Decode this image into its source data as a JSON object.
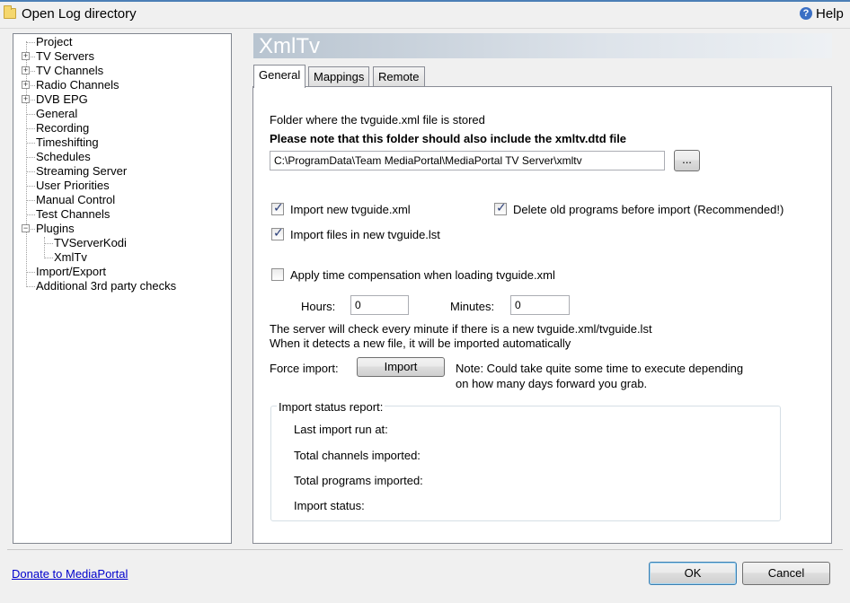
{
  "toolbar": {
    "open_log_label": "Open Log directory",
    "help_label": "Help"
  },
  "tree": {
    "items": [
      {
        "label": "Project"
      },
      {
        "label": "TV Servers"
      },
      {
        "label": "TV Channels"
      },
      {
        "label": "Radio Channels"
      },
      {
        "label": "DVB EPG"
      },
      {
        "label": "General"
      },
      {
        "label": "Recording"
      },
      {
        "label": "Timeshifting"
      },
      {
        "label": "Schedules"
      },
      {
        "label": "Streaming Server"
      },
      {
        "label": "User Priorities"
      },
      {
        "label": "Manual Control"
      },
      {
        "label": "Test Channels"
      },
      {
        "label": "Plugins"
      },
      {
        "label": "TVServerKodi"
      },
      {
        "label": "XmlTv"
      },
      {
        "label": "Import/Export"
      },
      {
        "label": "Additional 3rd party checks"
      }
    ]
  },
  "panel": {
    "title": "XmlTv",
    "tabs": [
      {
        "label": "General"
      },
      {
        "label": "Mappings"
      },
      {
        "label": "Remote"
      }
    ]
  },
  "general": {
    "folder_label": "Folder where the tvguide.xml file is stored",
    "folder_note": "Please note that this folder should also include the xmltv.dtd file",
    "folder_value": "C:\\ProgramData\\Team MediaPortal\\MediaPortal TV Server\\xmltv",
    "browse_label": "...",
    "import_new_label": "Import new tvguide.xml",
    "import_new_checked": true,
    "delete_old_label": "Delete old programs before import (Recommended!)",
    "delete_old_checked": true,
    "import_lst_label": "Import files in new tvguide.lst",
    "import_lst_checked": true,
    "time_comp_label": "Apply time compensation when loading tvguide.xml",
    "time_comp_checked": false,
    "hours_label": "Hours:",
    "hours_value": "0",
    "minutes_label": "Minutes:",
    "minutes_value": "0",
    "info_line1": "The server will check every minute if there is a new tvguide.xml/tvguide.lst",
    "info_line2": "When it detects a new file, it will be imported automatically",
    "force_import_label": "Force import:",
    "import_button": "Import",
    "note_line1": "Note: Could take quite some time to execute depending",
    "note_line2": "on how many days forward you grab.",
    "status_group_label": "Import status report:",
    "last_import_label": "Last import run at:",
    "total_channels_label": "Total channels imported:",
    "total_programs_label": "Total programs imported:",
    "import_status_label": "Import status:"
  },
  "footer": {
    "donate_label": "Donate to MediaPortal",
    "ok_label": "OK",
    "cancel_label": "Cancel"
  }
}
